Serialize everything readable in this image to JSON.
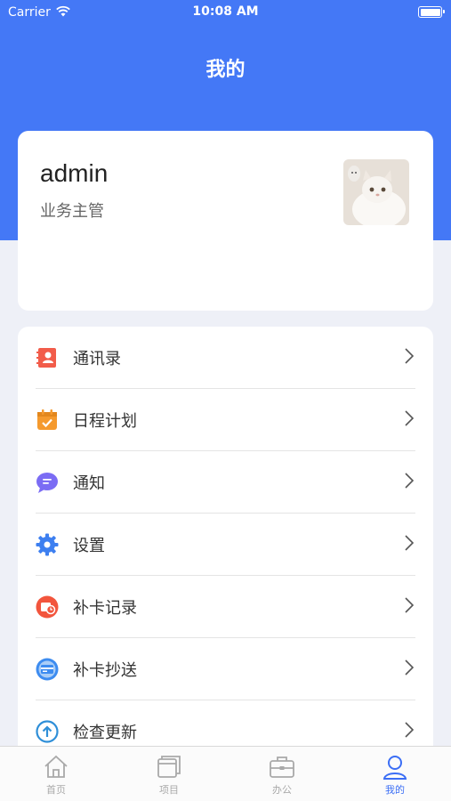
{
  "status": {
    "carrier": "Carrier",
    "time": "10:08 AM"
  },
  "page": {
    "title": "我的"
  },
  "profile": {
    "username": "admin",
    "role": "业务主管"
  },
  "menu": [
    {
      "label": "通讯录",
      "icon": "contacts-icon",
      "color": "#f25c4a"
    },
    {
      "label": "日程计划",
      "icon": "calendar-icon",
      "color": "#f59a2e"
    },
    {
      "label": "通知",
      "icon": "notification-icon",
      "color": "#7b6cf4"
    },
    {
      "label": "设置",
      "icon": "gear-icon",
      "color": "#3d7ff0"
    },
    {
      "label": "补卡记录",
      "icon": "clock-record-icon",
      "color": "#f2553d"
    },
    {
      "label": "补卡抄送",
      "icon": "card-icon",
      "color": "#3d8cf0"
    },
    {
      "label": "检查更新",
      "icon": "upload-arrow-icon",
      "color": "#2f8fd8"
    }
  ],
  "tabs": [
    {
      "label": "首页",
      "icon": "home-icon",
      "active": false
    },
    {
      "label": "项目",
      "icon": "project-icon",
      "active": false
    },
    {
      "label": "办公",
      "icon": "briefcase-icon",
      "active": false
    },
    {
      "label": "我的",
      "icon": "user-icon",
      "active": true
    }
  ],
  "colors": {
    "primary": "#4478f6",
    "tab_active": "#3b6ef5",
    "tab_inactive": "#a9a9a9"
  }
}
